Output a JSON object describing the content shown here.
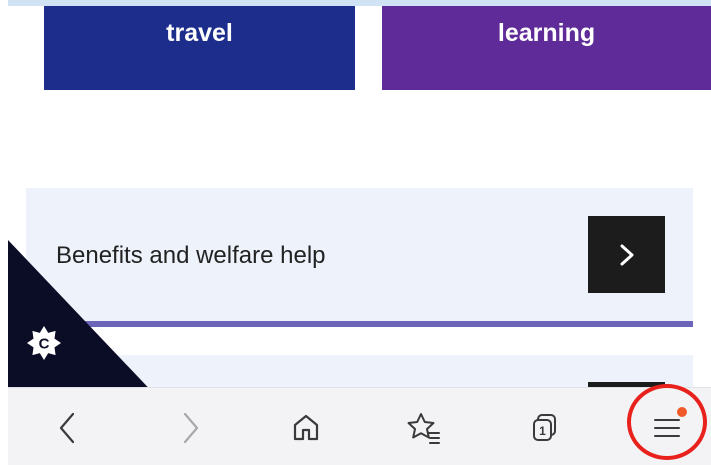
{
  "tiles": [
    {
      "label": "travel",
      "color": "#1d2d8c"
    },
    {
      "label": "learning",
      "color": "#5f2b99"
    }
  ],
  "cards": [
    {
      "title": "Benefits and welfare help"
    }
  ],
  "badge": {
    "letter": "C"
  },
  "toolbar": {
    "icons": [
      "back-icon",
      "forward-icon",
      "home-icon",
      "favorites-icon",
      "tabs-icon",
      "menu-icon"
    ],
    "tab_count": "1"
  },
  "colors": {
    "card_bg": "#eef2fb",
    "card_accent": "#6b64b8",
    "arrow_button": "#1c1c1c",
    "notification_dot": "#f05a28",
    "highlight": "#e8211c"
  }
}
